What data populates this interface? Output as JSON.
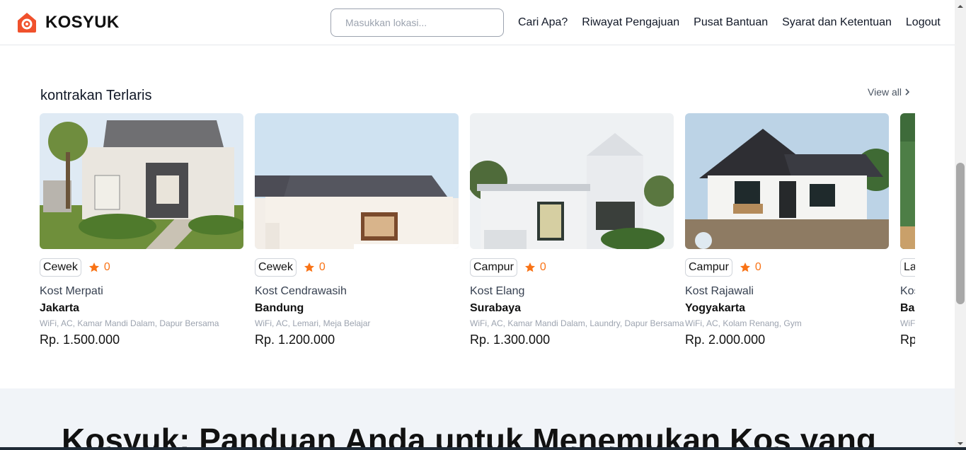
{
  "header": {
    "brand": "KOSYUK",
    "search": {
      "placeholder": "Masukkan lokasi...",
      "value": ""
    },
    "nav": [
      "Cari Apa?",
      "Riwayat Pengajuan",
      "Pusat Bantuan",
      "Syarat dan Ketentuan",
      "Logout"
    ]
  },
  "section": {
    "title": "kontrakan Terlaris",
    "view_all": "View all"
  },
  "cards": [
    {
      "badge": "Cewek",
      "rating": "0",
      "name": "Kost Merpati",
      "city": "Jakarta",
      "features": "WiFi, AC, Kamar Mandi Dalam, Dapur Bersama",
      "price": "Rp. 1.500.000"
    },
    {
      "badge": "Cewek",
      "rating": "0",
      "name": "Kost Cendrawasih",
      "city": "Bandung",
      "features": "WiFi, AC, Lemari, Meja Belajar",
      "price": "Rp. 1.200.000"
    },
    {
      "badge": "Campur",
      "rating": "0",
      "name": "Kost Elang",
      "city": "Surabaya",
      "features": "WiFi, AC, Kamar Mandi Dalam, Laundry, Dapur Bersama",
      "price": "Rp. 1.300.000"
    },
    {
      "badge": "Campur",
      "rating": "0",
      "name": "Kost Rajawali",
      "city": "Yogyakarta",
      "features": "WiFi, AC, Kolam Renang, Gym",
      "price": "Rp. 2.000.000"
    },
    {
      "badge": "La",
      "rating": "",
      "name": "Kos",
      "city": "Bal",
      "features": "WiF",
      "price": "Rp"
    }
  ],
  "banner": {
    "title": "Kosyuk: Panduan Anda untuk Menemukan Kos yang"
  },
  "colors": {
    "accent": "#f97316",
    "brand_logo": "#f0512c",
    "banner_bg": "#f1f4f8"
  },
  "icons": [
    "house-logo-icon",
    "chevron-right-icon",
    "star-icon"
  ]
}
